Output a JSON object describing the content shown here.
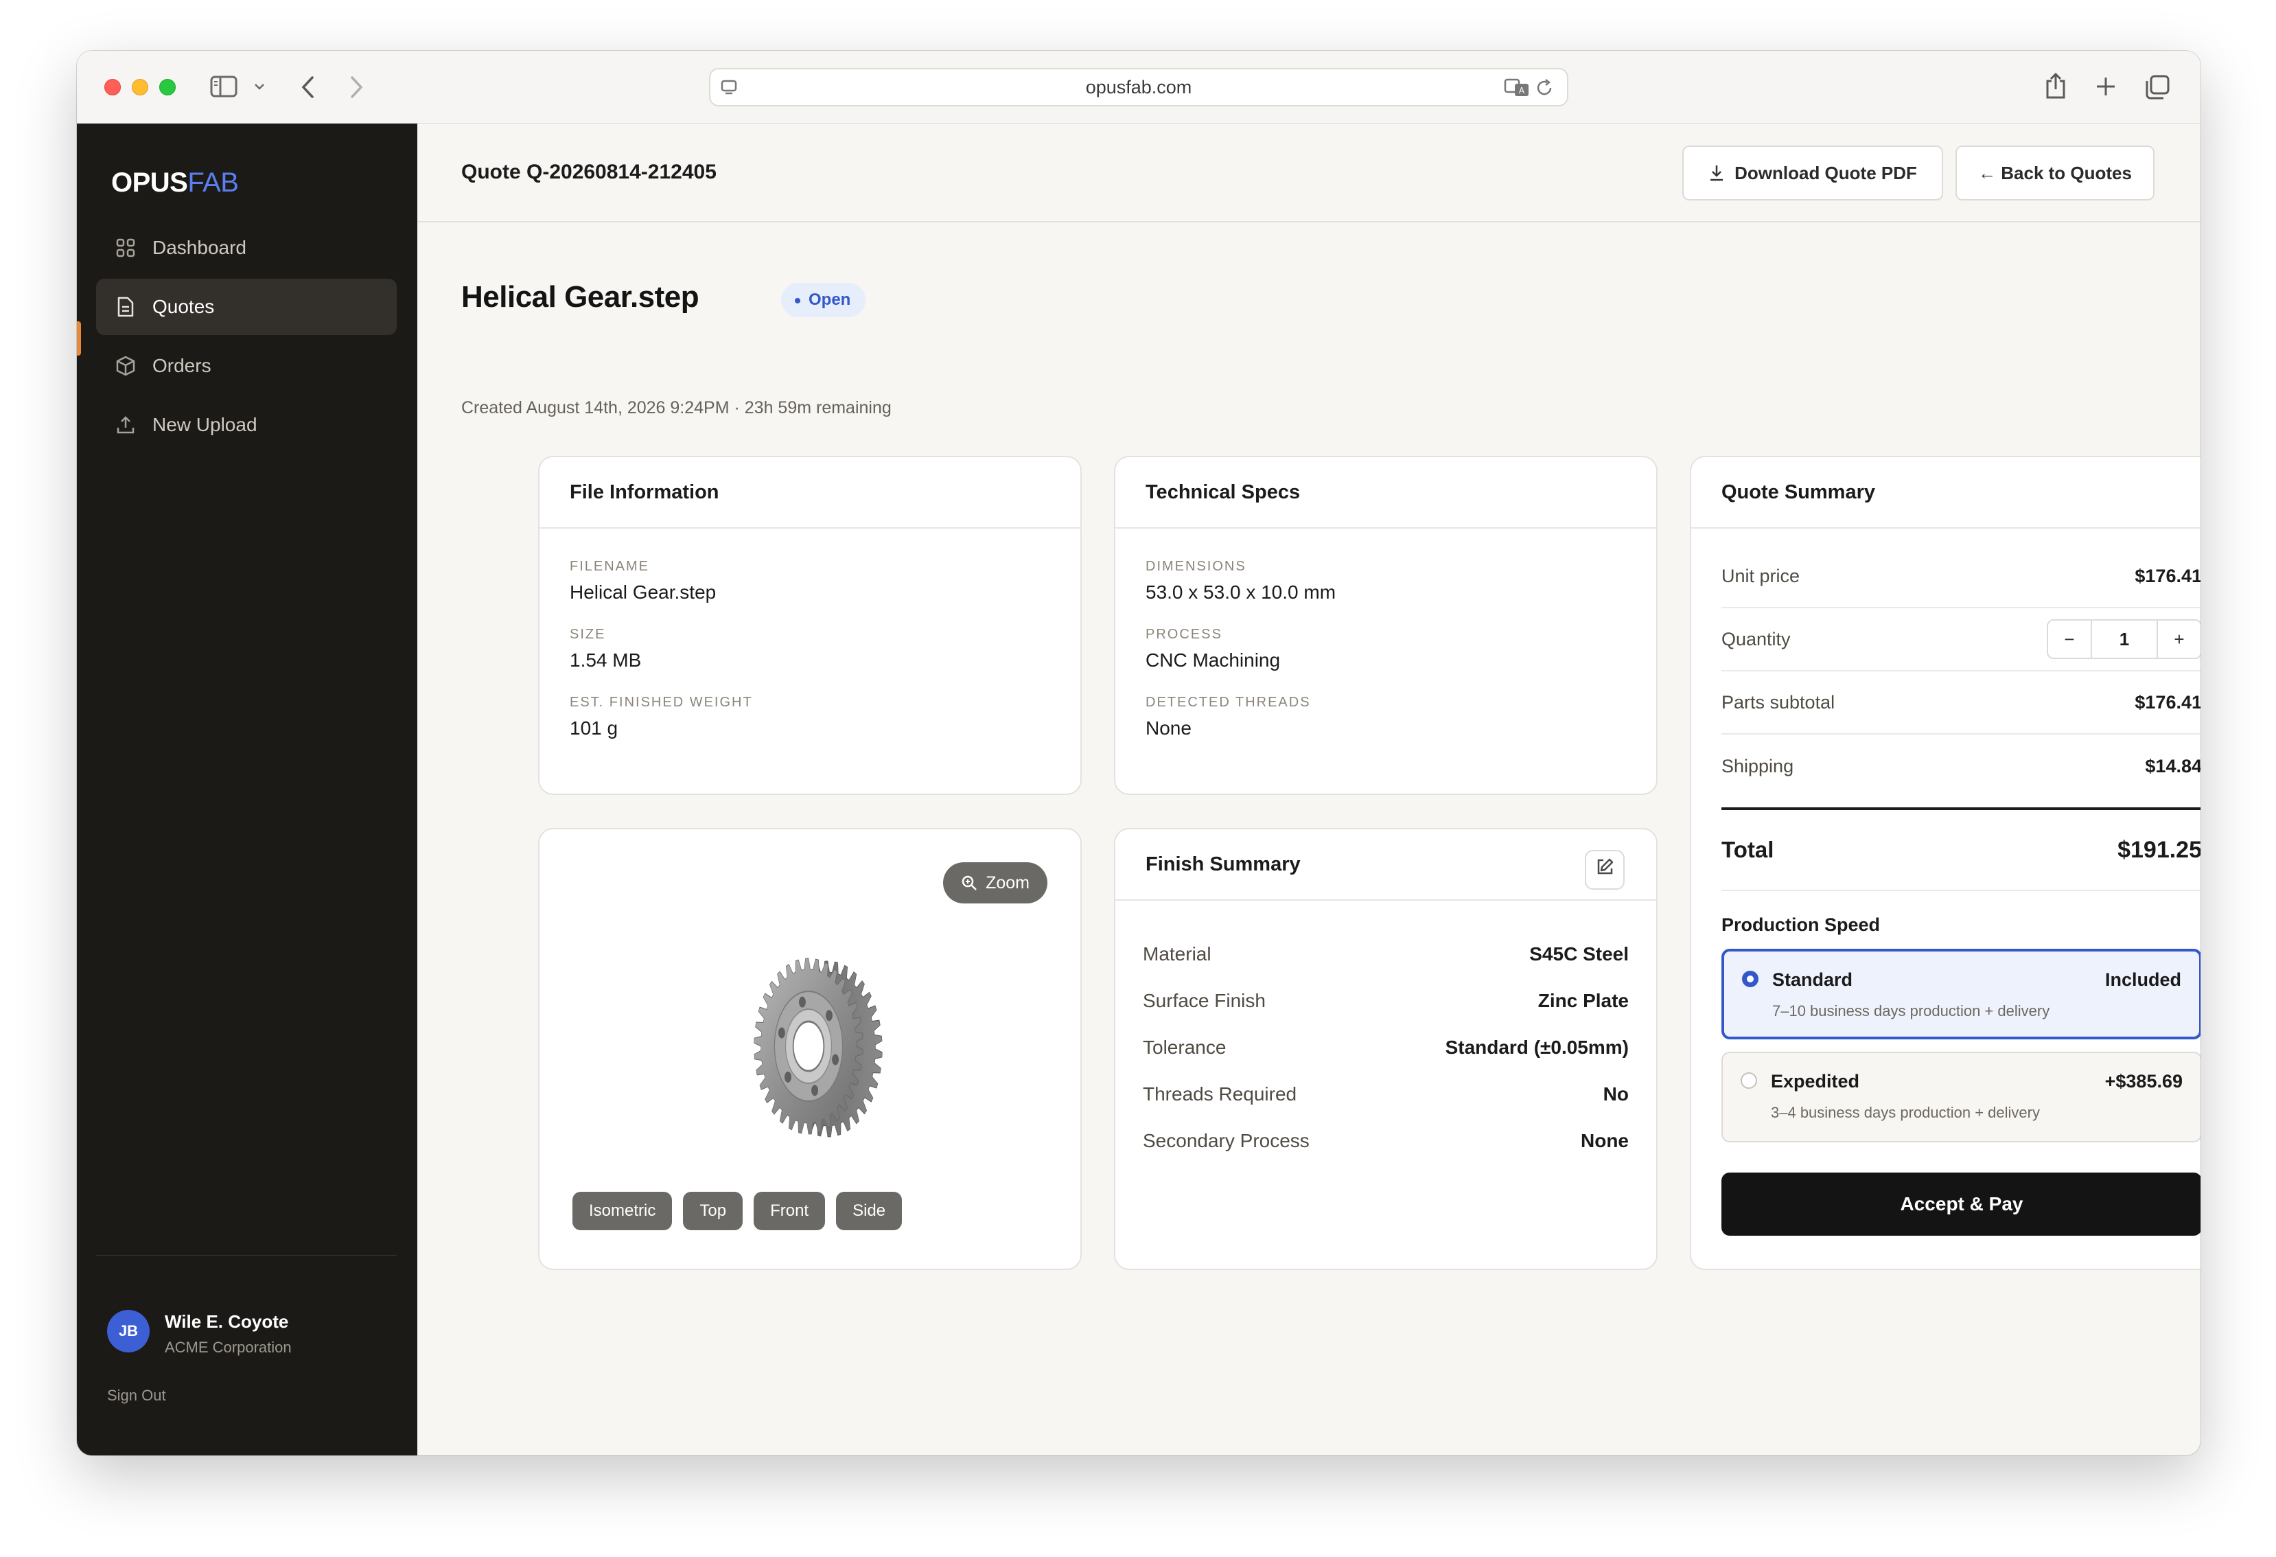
{
  "browser": {
    "url": "opusfab.com"
  },
  "sidebar": {
    "logo_part1": "OPUS",
    "logo_part2": "FAB",
    "items": [
      {
        "label": "Dashboard",
        "icon": "grid-icon"
      },
      {
        "label": "Quotes",
        "icon": "document-icon",
        "active": true
      },
      {
        "label": "Orders",
        "icon": "box-icon"
      },
      {
        "label": "New Upload",
        "icon": "upload-icon"
      }
    ],
    "user": {
      "initials": "JB",
      "name": "Wile E. Coyote",
      "org": "ACME Corporation"
    },
    "sign_out": "Sign Out"
  },
  "header": {
    "quote_id": "Quote Q-20260814-212405",
    "download_label": "Download Quote PDF",
    "back_label": "← Back to Quotes"
  },
  "quote": {
    "title": "Helical Gear.step",
    "status": "Open",
    "created": "Created August 14th, 2026 9:24PM · 23h 59m remaining"
  },
  "file_info": {
    "title": "File Information",
    "filename_label": "FILENAME",
    "filename": "Helical Gear.step",
    "size_label": "SIZE",
    "size": "1.54 MB",
    "weight_label": "EST. FINISHED WEIGHT",
    "weight": "101 g"
  },
  "tech_specs": {
    "title": "Technical Specs",
    "dimensions_label": "DIMENSIONS",
    "dimensions": "53.0 x 53.0 x 10.0 mm",
    "process_label": "PROCESS",
    "process": "CNC Machining",
    "threads_label": "DETECTED THREADS",
    "threads": "None"
  },
  "viewer": {
    "zoom_label": "Zoom",
    "views": [
      "Isometric",
      "Top",
      "Front",
      "Side"
    ]
  },
  "finish": {
    "title": "Finish Summary",
    "rows": [
      {
        "label": "Material",
        "value": "S45C Steel"
      },
      {
        "label": "Surface Finish",
        "value": "Zinc Plate"
      },
      {
        "label": "Tolerance",
        "value": "Standard (±0.05mm)"
      },
      {
        "label": "Threads Required",
        "value": "No"
      },
      {
        "label": "Secondary Process",
        "value": "None"
      }
    ]
  },
  "summary": {
    "title": "Quote Summary",
    "unit_price_label": "Unit price",
    "unit_price": "$176.41",
    "quantity_label": "Quantity",
    "quantity": "1",
    "minus": "−",
    "plus": "+",
    "subtotal_label": "Parts subtotal",
    "subtotal": "$176.41",
    "shipping_label": "Shipping",
    "shipping": "$14.84",
    "total_label": "Total",
    "total": "$191.25",
    "speed_title": "Production Speed",
    "speeds": [
      {
        "name": "Standard",
        "desc": "7–10 business days production + delivery",
        "price": "Included",
        "selected": true
      },
      {
        "name": "Expedited",
        "desc": "3–4 business days production + delivery",
        "price": "+$385.69",
        "selected": false
      }
    ],
    "accept_label": "Accept & Pay"
  },
  "colors": {
    "accent_blue": "#3358c9",
    "sidebar_bg": "#1c1a17",
    "active_marker": "#e8883a",
    "primary_button": "#141414"
  }
}
